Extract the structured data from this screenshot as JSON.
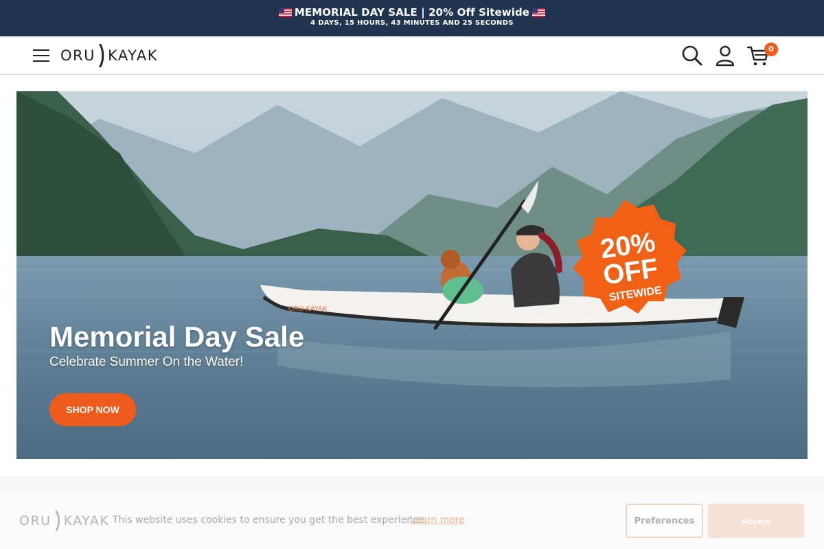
{
  "announcement": {
    "headline": "MEMORIAL DAY SALE | 20% Off Sitewide",
    "countdown": "4 DAYS, 15 HOURS, 43 MINUTES AND 25 SECONDS"
  },
  "header": {
    "logo_left": "ORU",
    "logo_right": "KAYAK",
    "cart_count": "0",
    "icons": [
      "menu-icon",
      "search-icon",
      "account-icon",
      "cart-icon"
    ]
  },
  "hero": {
    "title": "Memorial Day Sale",
    "subtitle": "Celebrate Summer On the Water!",
    "cta_label": "SHOP NOW",
    "badge_line1": "20%",
    "badge_line2": "OFF",
    "badge_line3": "SITEWIDE",
    "kayak_brand": "ORU KAYAK"
  },
  "cookie": {
    "logo_left": "ORU",
    "logo_right": "KAYAK",
    "message": "This website uses cookies to ensure you get the best experience.",
    "learn_more": "Learn more",
    "preferences_label": "Preferences",
    "accept_label": "Accept"
  },
  "colors": {
    "announcement_bg": "#21344f",
    "accent": "#ef5b1b"
  }
}
